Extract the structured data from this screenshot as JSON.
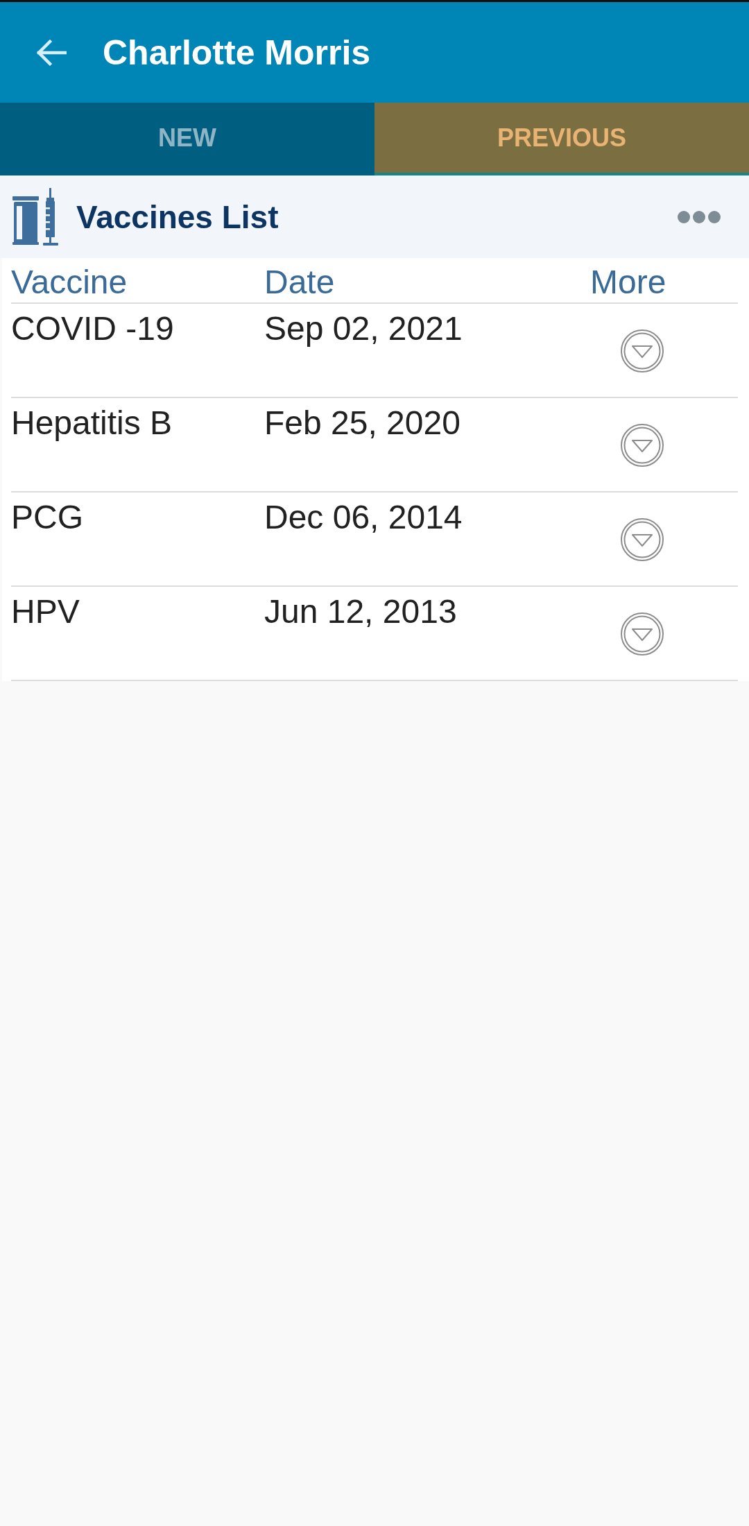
{
  "app_bar": {
    "title": "Charlotte Morris"
  },
  "tabs": [
    {
      "label": "NEW",
      "selected": false
    },
    {
      "label": "PREVIOUS",
      "selected": true
    }
  ],
  "section": {
    "title": "Vaccines List"
  },
  "table": {
    "columns": [
      "Vaccine",
      "Date",
      "More"
    ],
    "rows": [
      {
        "vaccine": "COVID -19",
        "date": "Sep 02, 2021"
      },
      {
        "vaccine": "Hepatitis B",
        "date": "Feb 25, 2020"
      },
      {
        "vaccine": "PCG",
        "date": "Dec 06, 2014"
      },
      {
        "vaccine": "HPV",
        "date": "Jun 12, 2013"
      }
    ]
  }
}
